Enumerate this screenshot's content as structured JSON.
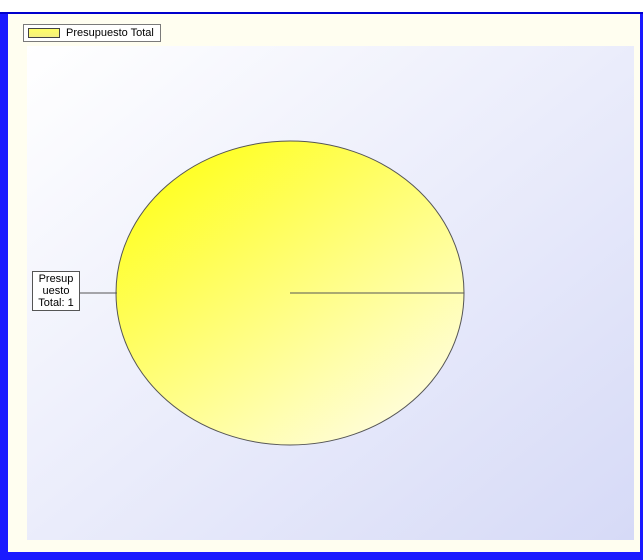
{
  "chart_data": {
    "type": "pie",
    "labels": [
      "Presupuesto Total"
    ],
    "values": [
      1
    ],
    "legend": "top-left",
    "data_labels": [
      "Presup uesto Total: 1"
    ]
  },
  "colors": {
    "slice_fill_light": "#fffccc",
    "slice_fill_dark": "#ffff22",
    "plot_bg_top": "#ffffff",
    "plot_bg_bottom": "#d8dcf8",
    "frame": "#1a1aff"
  },
  "legend": {
    "label": "Presupuesto Total"
  },
  "data_label": {
    "line1": "Presup",
    "line2": "uesto",
    "line3": "Total: 1"
  }
}
